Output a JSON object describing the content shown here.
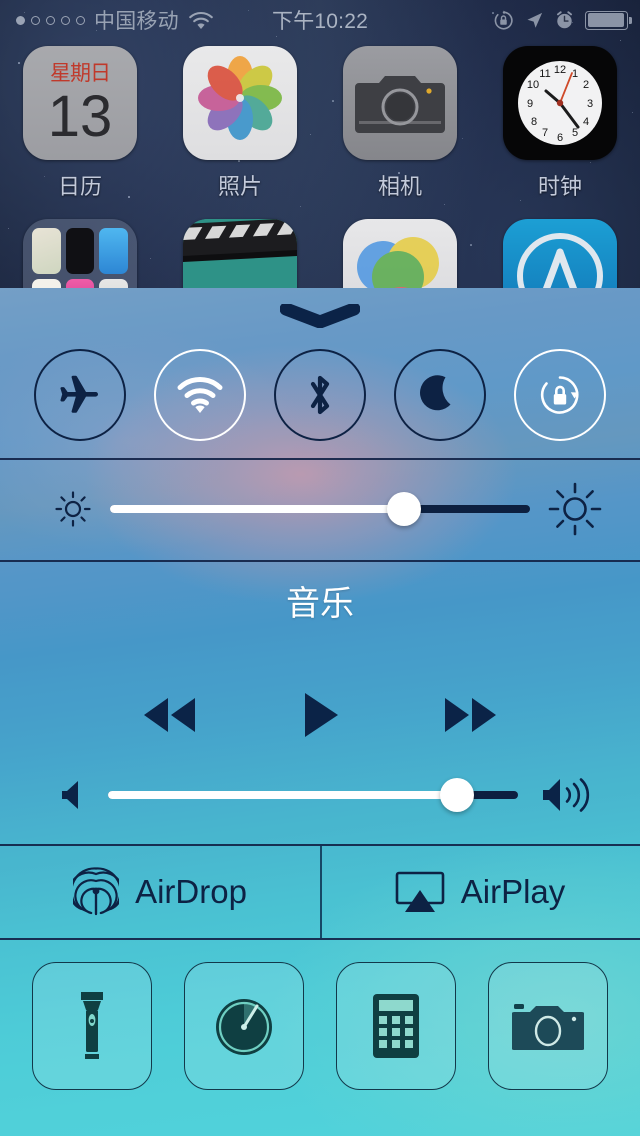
{
  "statusbar": {
    "signal_dots_total": 5,
    "signal_dots_filled": 1,
    "carrier": "中国移动",
    "wifi_icon": "wifi-icon",
    "time": "下午10:22",
    "rotation_lock_icon": "rotation-lock-icon",
    "location_icon": "location-arrow-icon",
    "alarm_icon": "alarm-clock-icon",
    "battery_icon": "battery-icon",
    "battery_level_pct": 88
  },
  "homescreen": {
    "row1": [
      {
        "label": "日历",
        "icon": "calendar-icon",
        "weekday": "星期日",
        "day": "13"
      },
      {
        "label": "照片",
        "icon": "photos-icon"
      },
      {
        "label": "相机",
        "icon": "camera-icon"
      },
      {
        "label": "时钟",
        "icon": "clock-icon",
        "time": "10:22"
      }
    ],
    "row2": [
      {
        "label": "",
        "icon": "folder-icon"
      },
      {
        "label": "",
        "icon": "videos-icon"
      },
      {
        "label": "",
        "icon": "game-center-icon"
      },
      {
        "label": "",
        "icon": "app-store-icon"
      }
    ]
  },
  "control_center": {
    "grabber_icon": "grabber-chevron-icon",
    "toggles": [
      {
        "name": "airplane-mode",
        "icon": "airplane-icon",
        "active": false
      },
      {
        "name": "wifi",
        "icon": "wifi-icon",
        "active": true
      },
      {
        "name": "bluetooth",
        "icon": "bluetooth-icon",
        "active": false
      },
      {
        "name": "do-not-disturb",
        "icon": "moon-icon",
        "active": false
      },
      {
        "name": "rotation-lock",
        "icon": "rotation-lock-icon",
        "active": true
      }
    ],
    "brightness": {
      "low_icon": "brightness-low-icon",
      "high_icon": "brightness-high-icon",
      "value_pct": 70
    },
    "music": {
      "title": "音乐",
      "rewind_icon": "rewind-icon",
      "play_icon": "play-icon",
      "forward_icon": "fast-forward-icon"
    },
    "volume": {
      "low_icon": "volume-low-icon",
      "high_icon": "volume-high-icon",
      "value_pct": 85
    },
    "airdrop": {
      "label": "AirDrop",
      "icon": "airdrop-icon"
    },
    "airplay": {
      "label": "AirPlay",
      "icon": "airplay-icon"
    },
    "shortcuts": [
      {
        "name": "flashlight",
        "icon": "flashlight-icon"
      },
      {
        "name": "timer",
        "icon": "timer-icon"
      },
      {
        "name": "calculator",
        "icon": "calculator-icon"
      },
      {
        "name": "camera",
        "icon": "camera-icon"
      }
    ]
  },
  "colors": {
    "panel_top": "#6f9cc4",
    "panel_bottom": "#4ad2da",
    "accent_dark": "#0d2244",
    "active_white": "#ffffff",
    "separator": "#122346",
    "calendar_red": "#c0392b"
  }
}
